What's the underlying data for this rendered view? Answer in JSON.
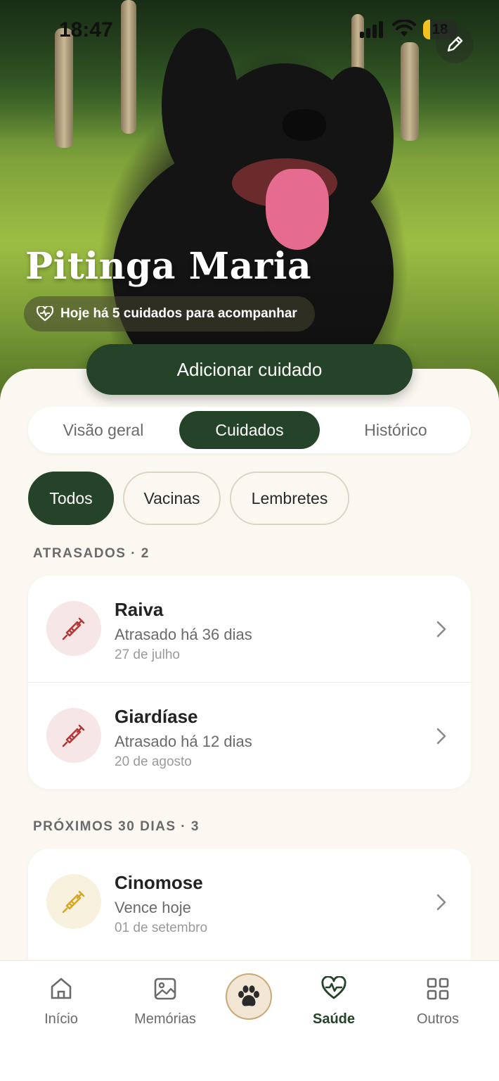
{
  "status_bar": {
    "time": "18:47",
    "battery": "18"
  },
  "pet": {
    "name": "Pitinga Maria",
    "care_summary": "Hoje há 5 cuidados para acompanhar"
  },
  "actions": {
    "add_care": "Adicionar cuidado"
  },
  "tabs": [
    {
      "label": "Visão geral",
      "active": false
    },
    {
      "label": "Cuidados",
      "active": true
    },
    {
      "label": "Histórico",
      "active": false
    }
  ],
  "filters": [
    {
      "label": "Todos",
      "active": true
    },
    {
      "label": "Vacinas",
      "active": false
    },
    {
      "label": "Lembretes",
      "active": false
    }
  ],
  "sections": {
    "overdue": {
      "title": "ATRASADOS · 2",
      "items": [
        {
          "title": "Raiva",
          "status": "Atrasado há 36 dias",
          "date": "27 de julho",
          "icon": "syringe-icon",
          "color": "#b03a3a"
        },
        {
          "title": "Giardíase",
          "status": "Atrasado há 12 dias",
          "date": "20 de agosto",
          "icon": "syringe-icon",
          "color": "#b03a3a"
        }
      ]
    },
    "upcoming": {
      "title": "PRÓXIMOS 30 DIAS · 3",
      "items": [
        {
          "title": "Cinomose",
          "status": "Vence hoje",
          "date": "01 de setembro",
          "icon": "syringe-icon",
          "color": "#d4a62a"
        }
      ]
    }
  },
  "bottom_nav": [
    {
      "label": "Início",
      "icon": "home-icon"
    },
    {
      "label": "Memórias",
      "icon": "image-icon"
    },
    {
      "label": "",
      "icon": "paw-icon"
    },
    {
      "label": "Saúde",
      "icon": "heart-pulse-icon",
      "active": true
    },
    {
      "label": "Outros",
      "icon": "grid-icon"
    }
  ],
  "colors": {
    "primary": "#244328",
    "background": "#fbf8f2",
    "danger": "#b03a3a",
    "warning": "#d4a62a"
  }
}
